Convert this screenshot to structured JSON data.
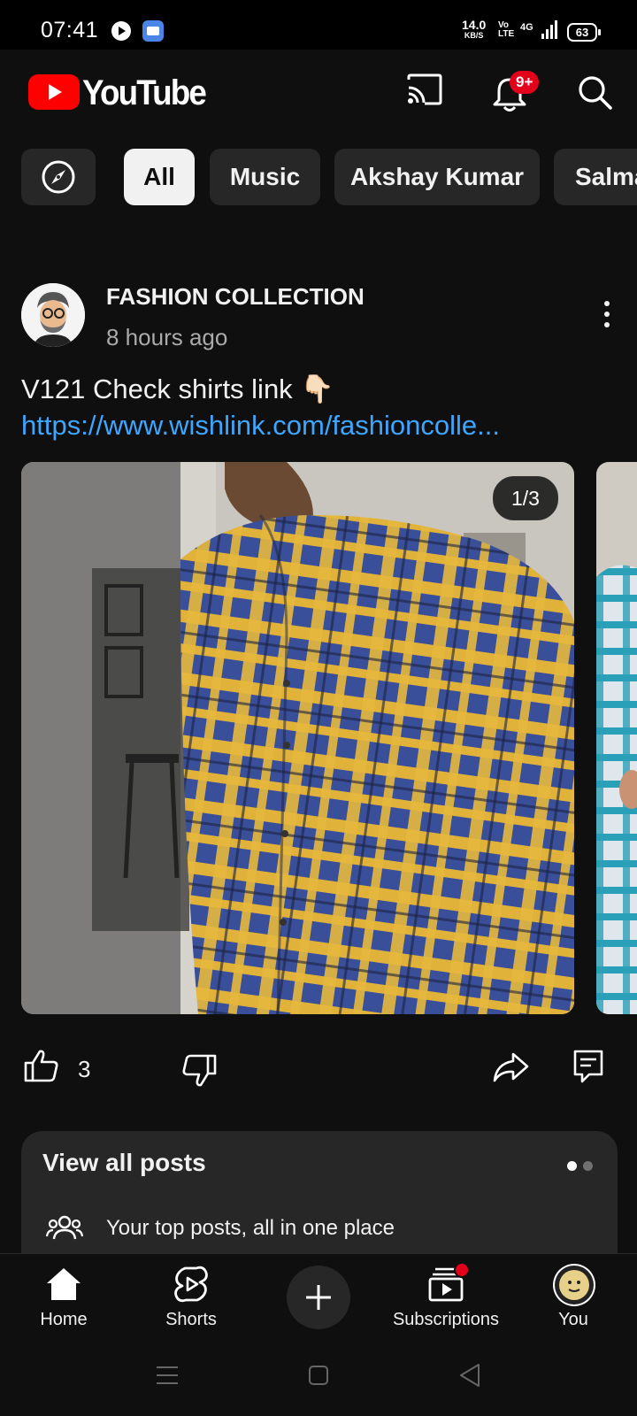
{
  "status_bar": {
    "time": "07:41",
    "speed_value": "14.0",
    "speed_unit": "KB/S",
    "volte_top": "Vo",
    "volte_bottom": "LTE",
    "network": "4G",
    "battery": "63",
    "icons": [
      "play-icon",
      "message-icon",
      "signal-icon",
      "battery-icon"
    ]
  },
  "header": {
    "logo_text": "YouTube",
    "notification_badge": "9+",
    "icons": [
      "cast-icon",
      "bell-icon",
      "search-icon"
    ],
    "brand_red": "#ff0000"
  },
  "chips": {
    "explore_icon": "compass-icon",
    "items": [
      {
        "label": "All",
        "selected": true
      },
      {
        "label": "Music",
        "selected": false
      },
      {
        "label": "Akshay Kumar",
        "selected": false
      },
      {
        "label": "Salma",
        "selected": false
      }
    ]
  },
  "post": {
    "channel_name": "FASHION COLLECTION",
    "time_ago": "8 hours ago",
    "text": "V121 Check shirts link 👇🏻",
    "link": "https://www.wishlink.com/fashioncolle...",
    "image_counter": "1/3",
    "like_count": "3",
    "link_color": "#3ea6ff"
  },
  "posts_card": {
    "title": "View all posts",
    "subtitle": "Your top posts, all in one place",
    "page_dots": 2,
    "active_dot": 0
  },
  "bottom_nav": {
    "items": [
      {
        "label": "Home",
        "icon": "home-icon"
      },
      {
        "label": "Shorts",
        "icon": "shorts-icon"
      },
      {
        "label": "",
        "icon": "plus-icon"
      },
      {
        "label": "Subscriptions",
        "icon": "subscriptions-icon"
      },
      {
        "label": "You",
        "icon": "avatar"
      }
    ]
  },
  "system_nav": {
    "icons": [
      "menu-icon",
      "home-square-icon",
      "back-icon"
    ]
  }
}
